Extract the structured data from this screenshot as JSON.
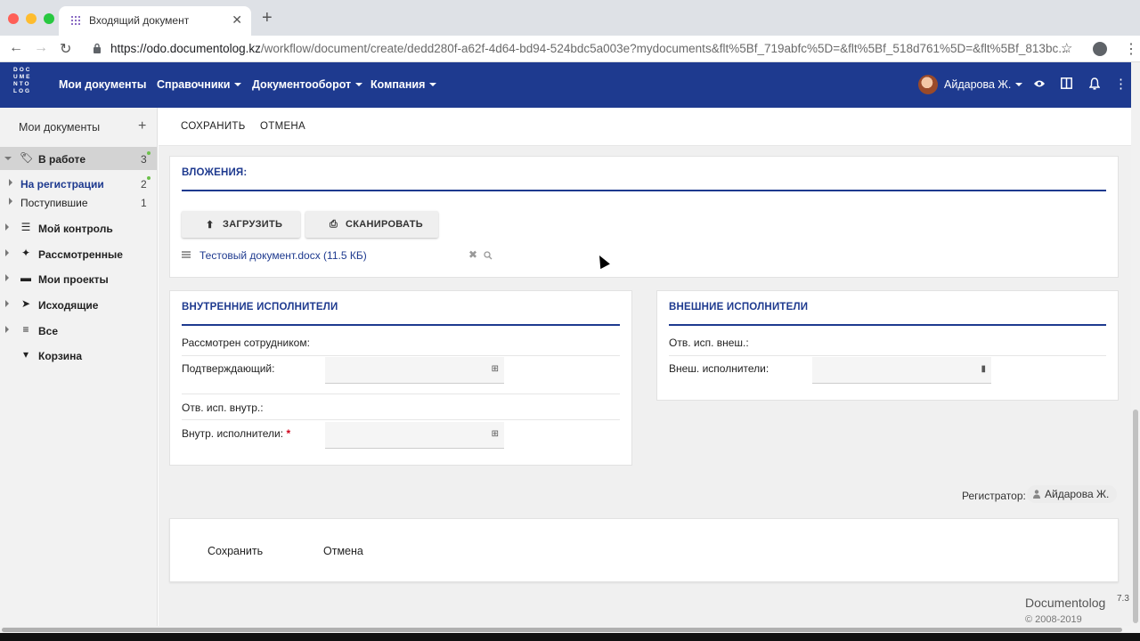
{
  "browser": {
    "tab_title": "Входящий документ",
    "url_host": "https://odo.documentolog.kz",
    "url_path": "/workflow/document/create/dedd280f-a62f-4d64-bd94-524bdc5a003e?mydocuments&flt%5Bf_719abfc%5D=&flt%5Bf_518d761%5D=&flt%5Bf_813bc..."
  },
  "header": {
    "logo_lines": [
      "DOC",
      "UME",
      "NTO",
      "LOG"
    ],
    "menu": [
      "Мои документы",
      "Справочники",
      "Документооборот",
      "Компания"
    ],
    "user_name": "Айдарова Ж.",
    "icons": [
      "eye-icon",
      "columns-icon",
      "bell-icon",
      "more-vert-icon"
    ]
  },
  "sidebar": {
    "title": "Мои документы",
    "items": [
      {
        "label": "В работе",
        "count": "3",
        "icon": "tags-icon"
      },
      {
        "label": "На регистрации",
        "count": "2"
      },
      {
        "label": "Поступившие",
        "count": "1"
      },
      {
        "label": "Мой контроль",
        "icon": "sliders-icon"
      },
      {
        "label": "Рассмотренные",
        "icon": "pin-icon"
      },
      {
        "label": "Мои проекты",
        "icon": "folder-icon"
      },
      {
        "label": "Исходящие",
        "icon": "send-icon"
      },
      {
        "label": "Все",
        "icon": "list-icon"
      },
      {
        "label": "Корзина",
        "icon": "trash-icon"
      }
    ]
  },
  "toolbar": {
    "save": "СОХРАНИТЬ",
    "cancel": "ОТМЕНА"
  },
  "attachments": {
    "title": "ВЛОЖЕНИЯ:",
    "upload": "ЗАГРУЗИТЬ",
    "scan": "СКАНИРОВАТЬ",
    "file": "Тестовый документ.docx (11.5 КБ)"
  },
  "internal": {
    "title": "ВНУТРЕННИЕ ИСПОЛНИТЕЛИ",
    "reviewed_by": "Рассмотрен сотрудником:",
    "confirming": "Подтверждающий:",
    "resp_internal": "Отв. исп. внутр.:",
    "internal_executors": "Внутр. исполнители:",
    "required_mark": "*"
  },
  "external": {
    "title": "ВНЕШНИЕ ИСПОЛНИТЕЛИ",
    "resp_external": "Отв. исп. внеш.:",
    "external_executors": "Внеш. исполнители:"
  },
  "registrar": {
    "label": "Регистратор:",
    "name": "Айдарова Ж."
  },
  "bottom": {
    "save": "Сохранить",
    "cancel": "Отмена"
  },
  "footer": {
    "brand": "Documentolog",
    "version": "7.3",
    "copyright": "© 2008-2019"
  },
  "colors": {
    "brand": "#1e3a8f",
    "badge": "#6cc04a",
    "required": "#d0021b"
  }
}
